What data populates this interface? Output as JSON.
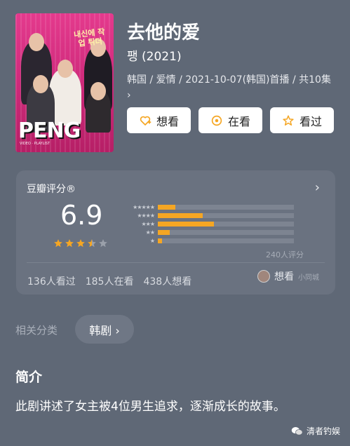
{
  "poster": {
    "korean_text": "내신에 작업 튀더",
    "logo": "PENG",
    "credit": "VIDEO · PLAYLIST"
  },
  "movie": {
    "title": "去他的爱",
    "subtitle": "팽 (2021)",
    "meta": "韩国 / 爱情 / 2021-10-07(韩国)首播 / 共10集 ›"
  },
  "actions": [
    {
      "label": "想看",
      "icon": "heart-plus-icon"
    },
    {
      "label": "在看",
      "icon": "target-icon"
    },
    {
      "label": "看过",
      "icon": "star-outline-icon"
    }
  ],
  "rating": {
    "header": "豆瓣评分®",
    "score": "6.9",
    "stars_value": 3.5,
    "stars_max": 5,
    "distribution": [
      {
        "label": "★★★★★",
        "fraction": 0.13
      },
      {
        "label": "★★★★",
        "fraction": 0.33
      },
      {
        "label": "★★★",
        "fraction": 0.41
      },
      {
        "label": "★★",
        "fraction": 0.09
      },
      {
        "label": "★",
        "fraction": 0.03
      }
    ],
    "votes": "240人评分",
    "counts": [
      "136人看过",
      "185人在看",
      "438人想看"
    ],
    "want_label": "想看",
    "want_sub": "小同城"
  },
  "related": {
    "label": "相关分类",
    "chip": "韩剧 ›"
  },
  "intro": {
    "heading": "简介",
    "text": "此剧讲述了女主被4位男生追求，逐渐成长的故事。"
  },
  "watermark": "清者钓娱",
  "colors": {
    "background": "#5f6876",
    "card": "#6a7280",
    "accent": "#f5a623"
  }
}
